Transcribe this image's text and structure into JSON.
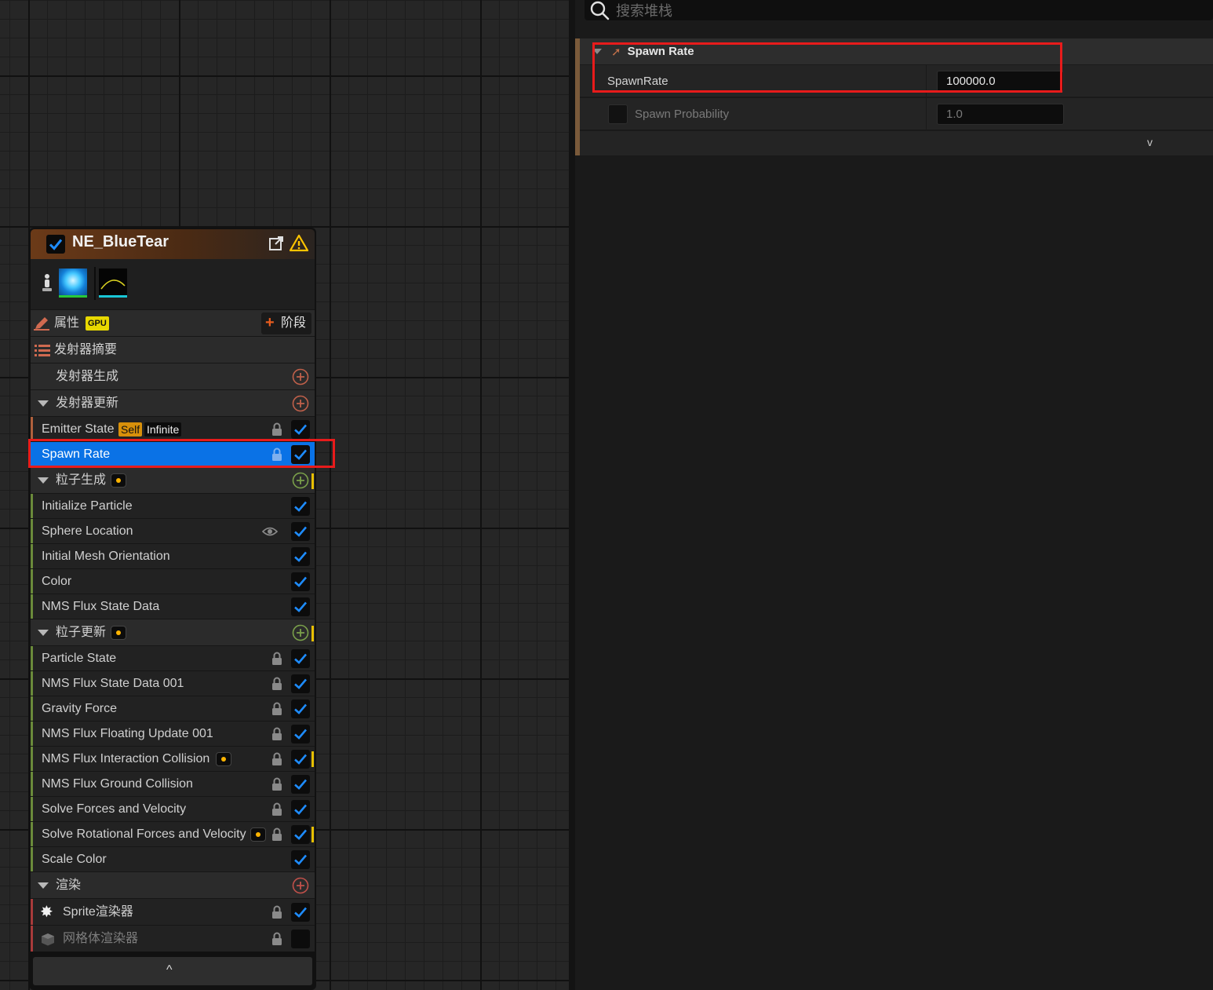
{
  "search": {
    "placeholder": "搜索堆栈"
  },
  "details": {
    "category_title": "Spawn Rate",
    "properties": [
      {
        "label": "SpawnRate",
        "value": "100000.0"
      },
      {
        "label": "Spawn Probability",
        "value": "1.0"
      }
    ],
    "expand_glyph": "v"
  },
  "node": {
    "title": "NE_BlueTear",
    "properties_label": "属性",
    "gpu_badge": "GPU",
    "stage_label": "阶段",
    "summary_label": "发射器摘要",
    "sections": {
      "emitter_spawn": "发射器生成",
      "emitter_update": "发射器更新",
      "particle_spawn": "粒子生成",
      "particle_update": "粒子更新",
      "render": "渲染"
    },
    "emitter_state": {
      "label": "Emitter State",
      "badge_self": "Self",
      "badge_infinite": "Infinite"
    },
    "spawn_rate": "Spawn Rate",
    "particle_spawn_items": [
      "Initialize Particle",
      "Sphere Location",
      "Initial Mesh Orientation",
      "Color",
      "NMS Flux State Data"
    ],
    "particle_update_items": [
      "Particle State",
      "NMS Flux State Data 001",
      "Gravity Force",
      "NMS Flux Floating Update 001",
      "NMS Flux Interaction Collision",
      "NMS Flux Ground Collision",
      "Solve Forces and Velocity",
      "Solve Rotational Forces and Velocity",
      "Scale Color"
    ],
    "renderers": [
      "Sprite渲染器",
      "网格体渲染器"
    ],
    "collapse_glyph": "^"
  },
  "colors": {
    "selection": "#0a72e6",
    "highlight_box": "#e81b1b",
    "checkbox_check": "#1e8cff",
    "emitter_bar": "#b0603c",
    "particle_bar": "#6a8a3a",
    "render_bar": "#a83a3a",
    "warning": "#ffc400"
  }
}
